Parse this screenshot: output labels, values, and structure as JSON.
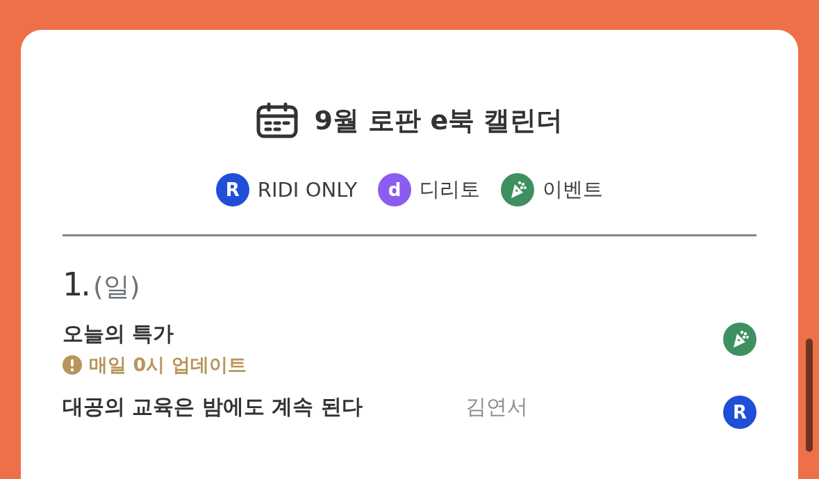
{
  "header": {
    "title": "9월 로판 e북 캘린더"
  },
  "legend": [
    {
      "kind": "ridi",
      "mark": "R",
      "label": "RIDI ONLY",
      "color": "#1f4fd6"
    },
    {
      "kind": "dritto",
      "mark": "d",
      "label": "디리토",
      "color": "#8b5cf0"
    },
    {
      "kind": "event",
      "label": "이벤트",
      "color": "#3f9060"
    }
  ],
  "day": {
    "date": "1.",
    "weekday": "(일)"
  },
  "entries": [
    {
      "title": "오늘의 특가",
      "note": "매일 0시 업데이트",
      "badge": {
        "kind": "event",
        "color": "#3f9060"
      }
    },
    {
      "title": "대공의 교육은 밤에도 계속 된다",
      "author": "김연서",
      "badge": {
        "kind": "ridi",
        "mark": "R",
        "color": "#1f4fd6"
      }
    }
  ]
}
